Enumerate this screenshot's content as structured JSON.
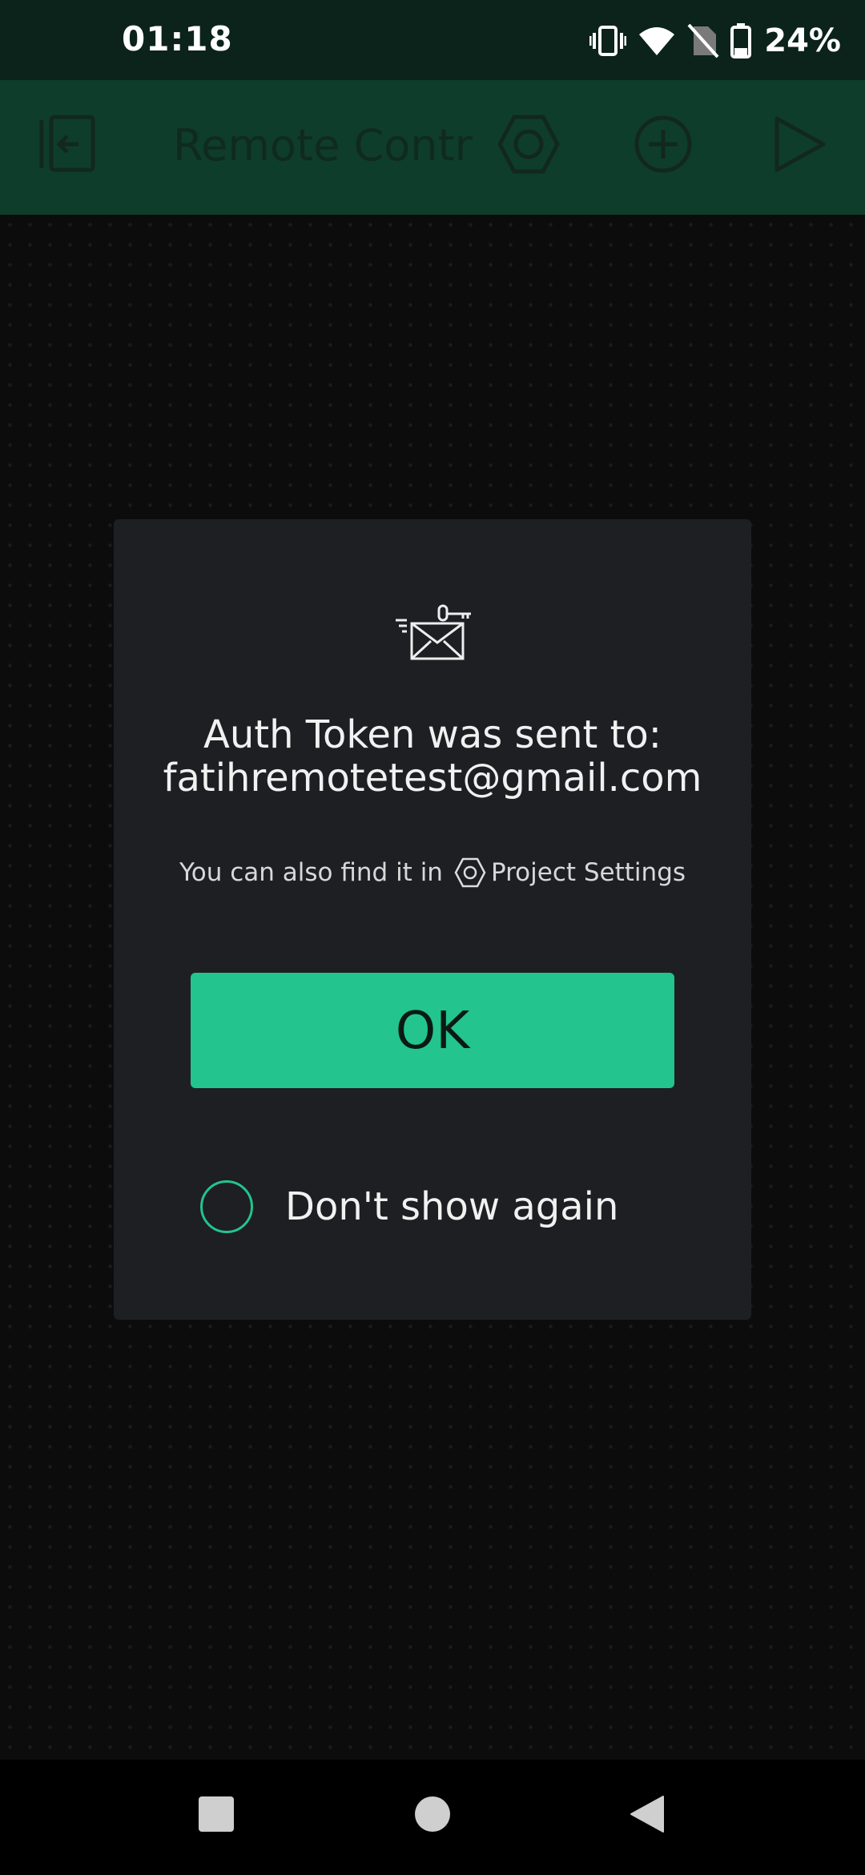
{
  "status_bar": {
    "time": "01:18",
    "battery_percent": "24%",
    "icons": [
      "vibrate-icon",
      "wifi-icon",
      "no-sim-icon",
      "battery-icon"
    ]
  },
  "toolbar": {
    "title": "Remote Contr",
    "icons": [
      "exit-project-icon",
      "settings-hexagon-icon",
      "add-widget-icon",
      "play-icon"
    ]
  },
  "dialog": {
    "title_line1": "Auth Token was sent to:",
    "title_line2": "fatihremotetest@gmail.com",
    "hint_prefix": "You can also find it in",
    "hint_link": "Project Settings",
    "ok_label": "OK",
    "dont_show_label": "Don't show again",
    "dont_show_checked": false
  },
  "nav_bar": {
    "buttons": [
      "recents-square-icon",
      "home-circle-icon",
      "back-triangle-icon"
    ]
  },
  "colors": {
    "accent": "#23c48e",
    "toolbar_bg": "#0e3d2c",
    "status_bg": "#0b231b",
    "dialog_bg": "#1e1f22"
  }
}
